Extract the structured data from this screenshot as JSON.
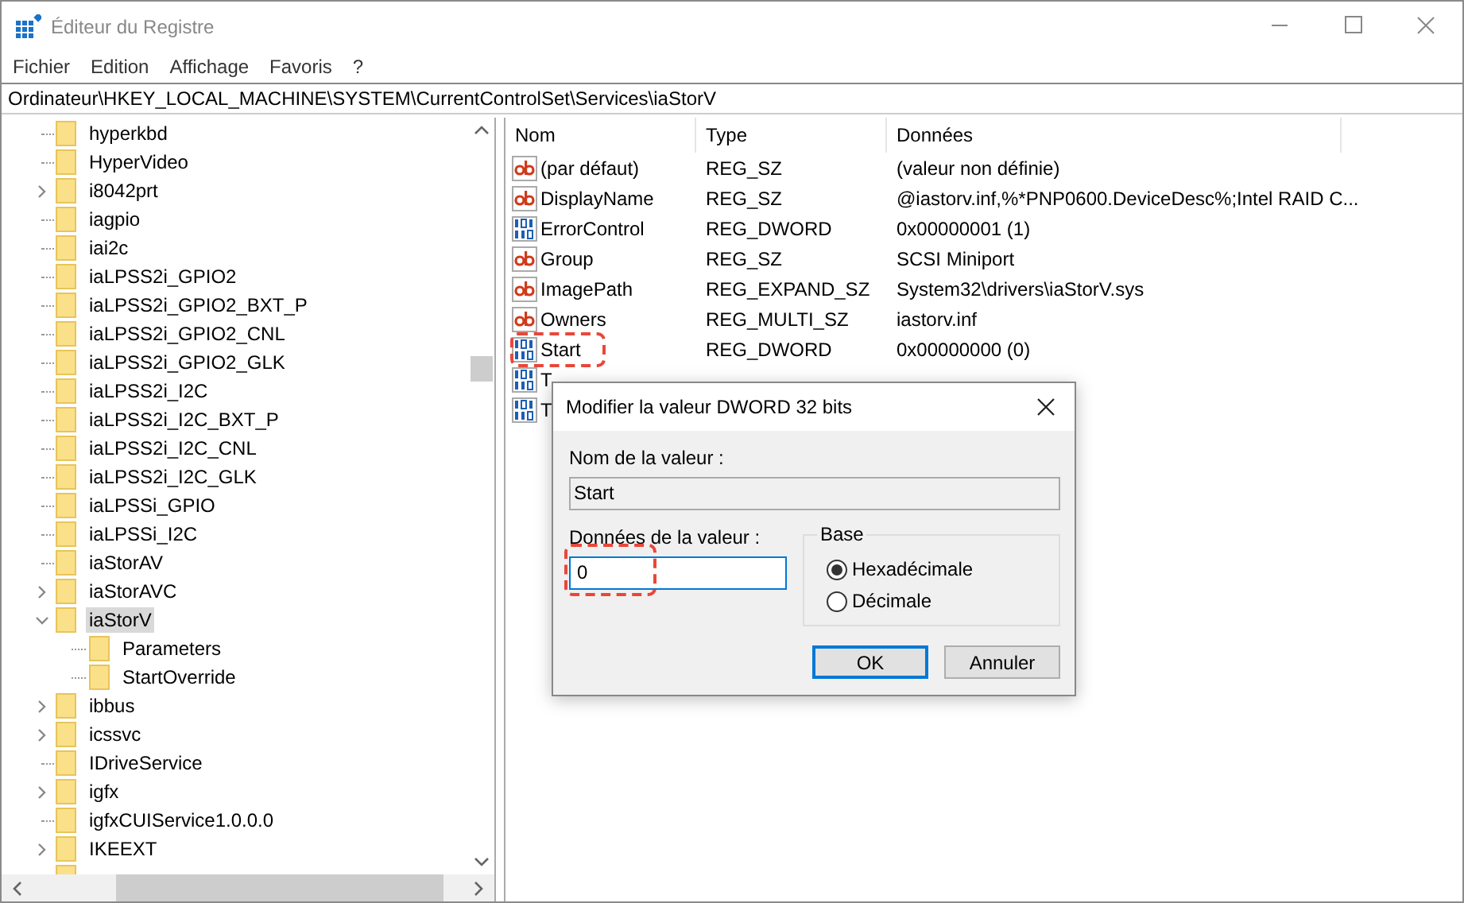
{
  "window": {
    "title": "Éditeur du Registre"
  },
  "menu": [
    "Fichier",
    "Edition",
    "Affichage",
    "Favoris",
    "?"
  ],
  "address": "Ordinateur\\HKEY_LOCAL_MACHINE\\SYSTEM\\CurrentControlSet\\Services\\iaStorV",
  "tree": [
    {
      "label": "hyperkbd",
      "selected": false
    },
    {
      "label": "HyperVideo",
      "selected": false
    },
    {
      "label": "i8042prt",
      "expanded": false,
      "selected": false
    },
    {
      "label": "iagpio",
      "selected": false
    },
    {
      "label": "iai2c",
      "selected": false
    },
    {
      "label": "iaLPSS2i_GPIO2",
      "selected": false
    },
    {
      "label": "iaLPSS2i_GPIO2_BXT_P",
      "selected": false
    },
    {
      "label": "iaLPSS2i_GPIO2_CNL",
      "selected": false
    },
    {
      "label": "iaLPSS2i_GPIO2_GLK",
      "selected": false
    },
    {
      "label": "iaLPSS2i_I2C",
      "selected": false
    },
    {
      "label": "iaLPSS2i_I2C_BXT_P",
      "selected": false
    },
    {
      "label": "iaLPSS2i_I2C_CNL",
      "selected": false
    },
    {
      "label": "iaLPSS2i_I2C_GLK",
      "selected": false
    },
    {
      "label": "iaLPSSi_GPIO",
      "selected": false
    },
    {
      "label": "iaLPSSi_I2C",
      "selected": false
    },
    {
      "label": "iaStorAV",
      "selected": false
    },
    {
      "label": "iaStorAVC",
      "expanded": false,
      "selected": false
    },
    {
      "label": "iaStorV",
      "expanded": true,
      "selected": true,
      "children": [
        {
          "label": "Parameters",
          "selected": false
        },
        {
          "label": "StartOverride",
          "selected": false
        }
      ]
    },
    {
      "label": "ibbus",
      "expanded": false,
      "selected": false
    },
    {
      "label": "icssvc",
      "expanded": false,
      "selected": false
    },
    {
      "label": "IDriveService",
      "selected": false
    },
    {
      "label": "igfx",
      "expanded": false,
      "selected": false
    },
    {
      "label": "igfxCUIService1.0.0.0",
      "selected": false
    },
    {
      "label": "IKEEXT",
      "expanded": false,
      "selected": false
    }
  ],
  "table": {
    "columns": [
      "Nom",
      "Type",
      "Données"
    ],
    "rows": [
      {
        "kind": "string",
        "name": "(par défaut)",
        "type": "REG_SZ",
        "data": "(valeur non définie)"
      },
      {
        "kind": "string",
        "name": "DisplayName",
        "type": "REG_SZ",
        "data": "@iastorv.inf,%*PNP0600.DeviceDesc%;Intel RAID C..."
      },
      {
        "kind": "dword",
        "name": "ErrorControl",
        "type": "REG_DWORD",
        "data": "0x00000001 (1)"
      },
      {
        "kind": "string",
        "name": "Group",
        "type": "REG_SZ",
        "data": "SCSI Miniport"
      },
      {
        "kind": "string",
        "name": "ImagePath",
        "type": "REG_EXPAND_SZ",
        "data": "System32\\drivers\\iaStorV.sys"
      },
      {
        "kind": "string",
        "name": "Owners",
        "type": "REG_MULTI_SZ",
        "data": "iastorv.inf"
      },
      {
        "kind": "dword",
        "name": "Start",
        "type": "REG_DWORD",
        "data": "0x00000000 (0)",
        "highlighted": true
      },
      {
        "kind": "dword",
        "name": "T"
      },
      {
        "kind": "dword",
        "name": "T"
      }
    ]
  },
  "dialog": {
    "title": "Modifier la valeur DWORD 32 bits",
    "name_label": "Nom de la valeur :",
    "name_value": "Start",
    "data_label": "Données de la valeur :",
    "data_value": "0",
    "data_highlighted": true,
    "base_label": "Base",
    "radios": [
      {
        "label": "Hexadécimale",
        "selected": true
      },
      {
        "label": "Décimale",
        "selected": false
      }
    ],
    "buttons": [
      {
        "label": "OK",
        "default": true
      },
      {
        "label": "Annuler",
        "default": false
      }
    ]
  }
}
